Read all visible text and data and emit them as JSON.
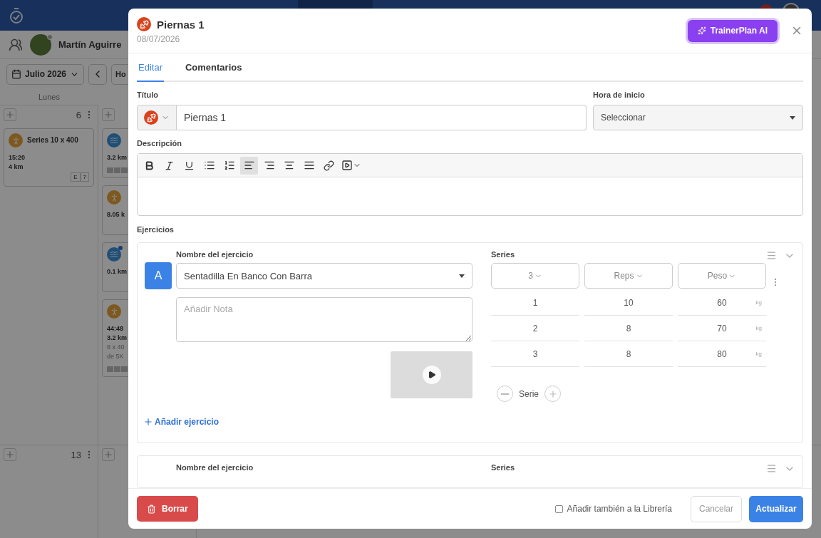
{
  "user": {
    "name": "Martín Aguirre"
  },
  "calendar": {
    "month": "Julio 2026",
    "today_button": "Ho",
    "weekday": "Lunes",
    "weeks": [
      {
        "days": [
          {
            "number": "6",
            "workouts": [
              {
                "kind": "run",
                "title": "Series 10 x 400",
                "lines": [
                  "15:20",
                  "4 km"
                ],
                "tags": [
                  "E",
                  "7"
                ],
                "dot": false
              }
            ]
          },
          {
            "workouts": [
              {
                "kind": "swim",
                "lines": [
                  "3.2 km"
                ],
                "dot": false,
                "bars": true
              },
              {
                "kind": "run",
                "lines": [
                  "8.05 k"
                ],
                "dot": false
              },
              {
                "kind": "swim",
                "lines": [
                  "0.1 km"
                ],
                "dot": true
              },
              {
                "kind": "run",
                "lines": [
                  "44:48",
                  "3.2 km"
                ],
                "notes": [
                  "8 x 40",
                  "de 5K"
                ],
                "dot": false,
                "bars": true
              }
            ]
          }
        ]
      },
      {
        "days": [
          {
            "number": "13"
          }
        ]
      }
    ]
  },
  "modal": {
    "title": "Piernas 1",
    "date": "08/07/2026",
    "ai_button": "TrainerPlan AI",
    "tabs": [
      {
        "label": "Editar",
        "selected": true
      },
      {
        "label": "Comentarios",
        "selected": false
      }
    ],
    "form": {
      "title_label": "Título",
      "title_value": "Piernas 1",
      "start_label": "Hora de inicio",
      "start_value": "Seleccionar",
      "description_label": "Descripción",
      "editor_tools": [
        {
          "kind": "bold",
          "selected": false
        },
        {
          "kind": "italic",
          "selected": false
        },
        {
          "kind": "underline",
          "selected": false
        },
        {
          "kind": "bullets",
          "selected": false
        },
        {
          "kind": "numbers",
          "selected": false
        },
        {
          "kind": "align-left",
          "selected": true
        },
        {
          "kind": "align-right",
          "selected": false
        },
        {
          "kind": "align-center",
          "selected": false
        },
        {
          "kind": "justify",
          "selected": false
        },
        {
          "kind": "link",
          "selected": false
        },
        {
          "kind": "media",
          "selected": false
        }
      ]
    },
    "exercises_label": "Ejercicios",
    "exercises": [
      {
        "letter": "A",
        "name_label": "Nombre del ejercicio",
        "name": "Sentadilla En Banco Con Barra",
        "note_placeholder": "Añadir Nota",
        "video": true,
        "series_label": "Series",
        "columns": [
          "3",
          "Reps",
          "Peso"
        ],
        "sets": [
          {
            "set": "1",
            "reps": "10",
            "weight": "60",
            "unit": "kg"
          },
          {
            "set": "2",
            "reps": "8",
            "weight": "70",
            "unit": "kg"
          },
          {
            "set": "3",
            "reps": "8",
            "weight": "80",
            "unit": "kg"
          }
        ],
        "set_control": "Serie",
        "add_link": "Añadir ejercicio"
      },
      {
        "name_label": "Nombre del ejercicio",
        "series_label": "Series"
      }
    ],
    "footer": {
      "delete": "Borrar",
      "library": {
        "label": "Añadir también a la Librería",
        "checked": false
      },
      "cancel": "Cancelar",
      "submit": "Actualizar"
    }
  }
}
